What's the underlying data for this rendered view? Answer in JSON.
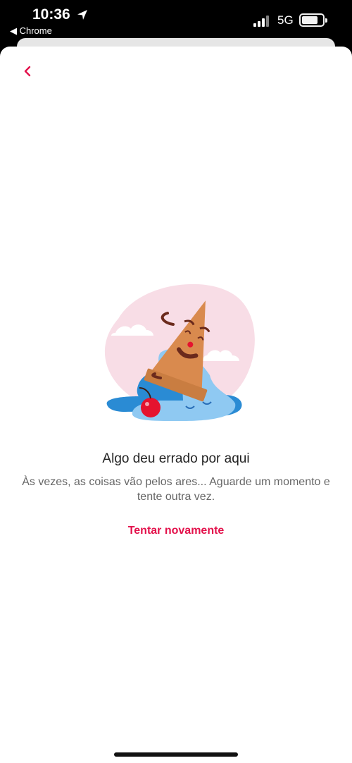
{
  "status_bar": {
    "time": "10:36",
    "back_app": "◀ Chrome",
    "network": "5G"
  },
  "nav": {
    "back_icon": "chevron-left-icon"
  },
  "error": {
    "illustration": "fallen-ice-cream-icon",
    "title": "Algo deu errado por aqui",
    "message": "Às vezes, as coisas vão pelos ares... Aguarde um momento e tente outra vez.",
    "retry_label": "Tentar novamente"
  },
  "colors": {
    "accent": "#e3114b",
    "blob": "#f8dde6",
    "cone": "#d98a4e",
    "ice_cream": "#8fc9f2",
    "puddle": "#2a8bd4",
    "cherry": "#e5132f"
  }
}
